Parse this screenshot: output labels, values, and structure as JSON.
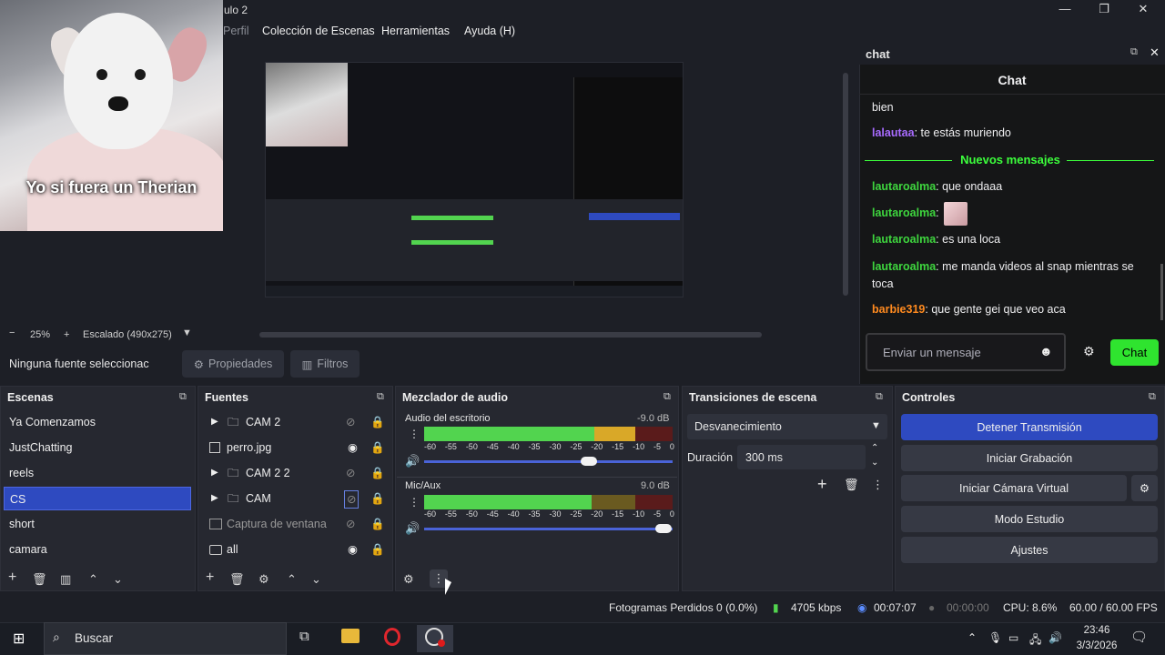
{
  "window": {
    "title": "ulo 2",
    "minimize": "—",
    "maximize": "❐",
    "close": "✕"
  },
  "menu": {
    "items": [
      "Perfil",
      "Colección de Escenas",
      "Herramientas",
      "Ayuda (H)"
    ]
  },
  "preview": {
    "overlay_caption": "Yo si fuera un Therian",
    "zoom_minus": "−",
    "zoom": "25%",
    "scaling": "Escalado (490x275)"
  },
  "source_toolbar": {
    "no_source": "Ninguna fuente seleccionac",
    "properties": "Propiedades",
    "filters": "Filtros"
  },
  "chat_dock": {
    "dock_title": "chat",
    "header": "Chat",
    "messages": [
      {
        "user": "",
        "text": "bien",
        "color": "#efeff1"
      },
      {
        "user": "lalautaa",
        "text": ": te estás muriendo",
        "color": "#a86bff"
      },
      {
        "user": "lautaroalma",
        "text": ": que ondaaa",
        "color": "#3ed63e"
      },
      {
        "user": "lautaroalma",
        "text": ":",
        "color": "#3ed63e"
      },
      {
        "user": "lautaroalma",
        "text": ": es una loca",
        "color": "#3ed63e"
      },
      {
        "user": "lautaroalma",
        "text": ": me manda videos al snap mientras se toca",
        "color": "#3ed63e"
      },
      {
        "user": "barbie319",
        "text": ": que gente gei que veo aca",
        "color": "#ff8a1f"
      }
    ],
    "new_messages_divider": "Nuevos mensajes",
    "input_placeholder": "Enviar un mensaje",
    "send_label": "Chat"
  },
  "scenes": {
    "title": "Escenas",
    "items": [
      "Ya Comenzamos",
      "JustChatting",
      "reels",
      "CS",
      "short",
      "camara"
    ],
    "selected": "CS"
  },
  "sources": {
    "title": "Fuentes",
    "items": [
      {
        "name": "CAM 2",
        "type": "folder",
        "visible": false
      },
      {
        "name": "perro.jpg",
        "type": "image",
        "visible": true
      },
      {
        "name": "CAM 2 2",
        "type": "folder",
        "visible": false
      },
      {
        "name": "CAM",
        "type": "folder",
        "visible": false
      },
      {
        "name": "Captura de ventana",
        "type": "window",
        "visible": false
      },
      {
        "name": "all",
        "type": "display",
        "visible": true
      }
    ]
  },
  "mixer": {
    "title": "Mezclador de audio",
    "tracks": [
      {
        "name": "Audio del escritorio",
        "db": "-9.0 dB",
        "level": 0.8
      },
      {
        "name": "Mic/Aux",
        "db": "9.0 dB",
        "level": 1.0
      }
    ],
    "ticks": [
      "-60",
      "-55",
      "-50",
      "-45",
      "-40",
      "-35",
      "-30",
      "-25",
      "-20",
      "-15",
      "-10",
      "-5",
      "0"
    ]
  },
  "transitions": {
    "title": "Transiciones de escena",
    "selected": "Desvanecimiento",
    "duration_label": "Duración",
    "duration_value": "300 ms"
  },
  "controls": {
    "title": "Controles",
    "buttons": [
      "Detener Transmisión",
      "Iniciar Grabación",
      "Iniciar Cámara Virtual",
      "Modo Estudio",
      "Ajustes"
    ]
  },
  "status": {
    "dropped_frames": "Fotogramas Perdidos 0 (0.0%)",
    "bitrate": "4705 kbps",
    "stream_time": "00:07:07",
    "rec_time": "00:00:00",
    "cpu": "CPU: 8.6%",
    "fps": "60.00 / 60.00 FPS"
  },
  "taskbar": {
    "search": "Buscar",
    "time": "23:46",
    "date": "3/3/2026"
  }
}
